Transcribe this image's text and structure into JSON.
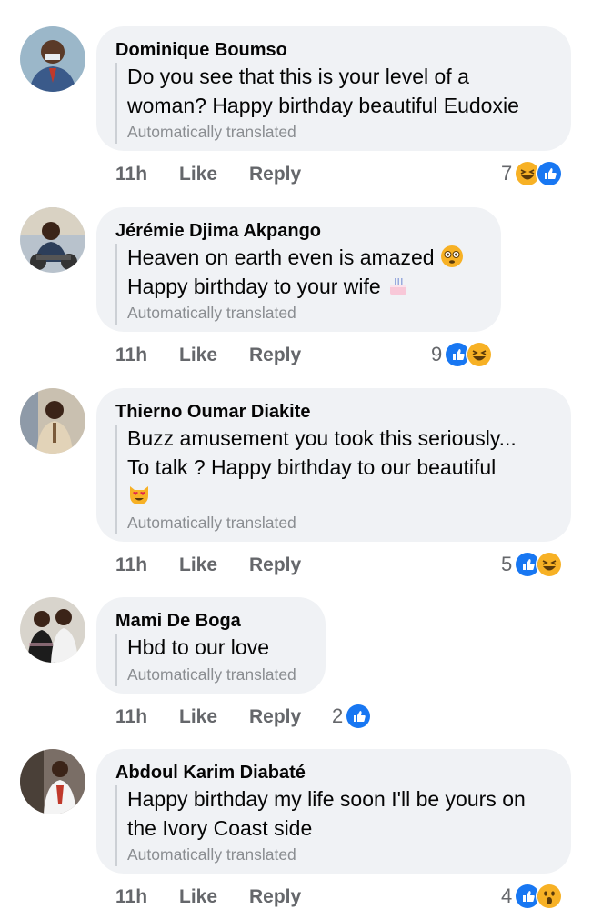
{
  "comments": [
    {
      "author": "Dominique Boumso",
      "lines": [
        "Do you see that this is your level of a",
        "woman? Happy birthday beautiful Eudoxie"
      ],
      "translated": "Automatically translated",
      "time": "11h",
      "like": "Like",
      "reply": "Reply",
      "reaction_count": "7",
      "reactions": [
        "haha-icon",
        "like-icon"
      ]
    },
    {
      "author": "Jérémie Djima Akpango",
      "lines": [
        "Heaven on earth even is amazed",
        "Happy birthday to your wife"
      ],
      "translated": "Automatically translated",
      "time": "11h",
      "like": "Like",
      "reply": "Reply",
      "reaction_count": "9",
      "reactions": [
        "like-icon",
        "haha-icon"
      ]
    },
    {
      "author": "Thierno Oumar Diakite",
      "lines": [
        "Buzz amusement you took this seriously...",
        "To talk ? Happy birthday to our beautiful"
      ],
      "translated": "Automatically translated",
      "time": "11h",
      "like": "Like",
      "reply": "Reply",
      "reaction_count": "5",
      "reactions": [
        "like-icon",
        "haha-icon"
      ]
    },
    {
      "author": "Mami De Boga",
      "lines": [
        "Hbd to our love"
      ],
      "translated": "Automatically translated",
      "time": "11h",
      "like": "Like",
      "reply": "Reply",
      "reaction_count": "2",
      "reactions": [
        "like-icon"
      ]
    },
    {
      "author": "Abdoul Karim Diabaté",
      "lines": [
        "Happy birthday my life soon I'll be yours on",
        "the Ivory Coast side"
      ],
      "translated": "Automatically translated",
      "time": "11h",
      "like": "Like",
      "reply": "Reply",
      "reaction_count": "4",
      "reactions": [
        "like-icon",
        "wow-icon"
      ]
    }
  ],
  "colors": {
    "bubble": "#f0f2f5",
    "meta_text": "#65676b",
    "translated_text": "#8a8d91",
    "like_blue": "#1877f2",
    "emoji_yellow": "#f7b125"
  }
}
